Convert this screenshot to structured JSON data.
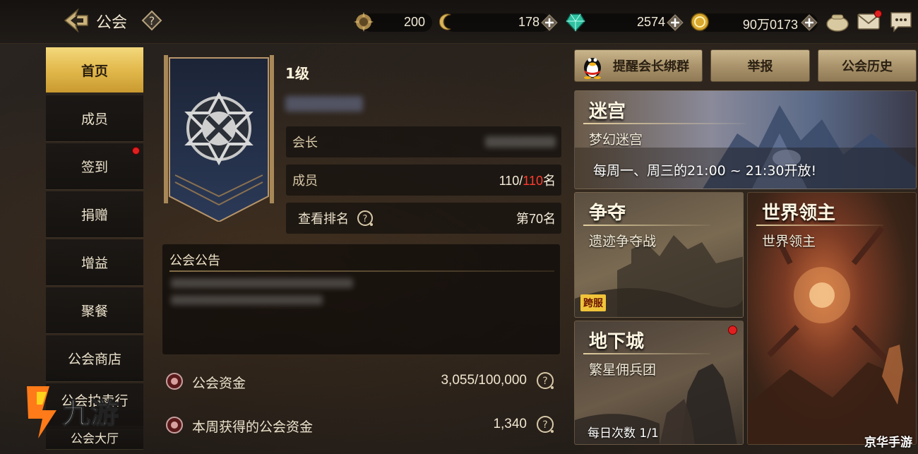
{
  "header": {
    "title": "公会",
    "resources": [
      {
        "icon": "sun-medal-icon",
        "value": "200",
        "has_plus": false
      },
      {
        "icon": "gold-crescent-icon",
        "value": "178",
        "has_plus": true
      },
      {
        "icon": "green-crystal-icon",
        "value": "2574",
        "has_plus": true
      },
      {
        "icon": "gold-coin-icon",
        "value": "90万0173",
        "has_plus": true
      }
    ]
  },
  "sidebar": {
    "items": [
      {
        "label": "首页",
        "active": true
      },
      {
        "label": "成员"
      },
      {
        "label": "签到",
        "badge": true
      },
      {
        "label": "捐赠"
      },
      {
        "label": "增益"
      },
      {
        "label": "聚餐"
      },
      {
        "label": "公会商店"
      },
      {
        "label": "公会拍卖行"
      },
      {
        "label": "公会大厅"
      }
    ]
  },
  "guild": {
    "level": "1级",
    "leader_label": "会长",
    "members_label": "成员",
    "members_current": "110/",
    "members_max": "110",
    "members_unit": "名",
    "rank_label": "查看排名",
    "rank_value": "第70名"
  },
  "notice": {
    "title": "公会公告"
  },
  "funds": [
    {
      "label": "公会资金",
      "value": "3,055/100,000"
    },
    {
      "label": "本周获得的公会资金",
      "value": "1,340"
    }
  ],
  "actions": {
    "remind": "提醒会长绑群",
    "report": "举报",
    "history": "公会历史"
  },
  "activities": {
    "maze": {
      "title": "迷宫",
      "subtitle": "梦幻迷宫",
      "desc": "每周一、周三的21:00 ~ 21:30开放!"
    },
    "contest": {
      "title": "争夺",
      "subtitle": "遗迹争夺战",
      "tag": "跨服"
    },
    "world_boss": {
      "title": "世界领主",
      "subtitle": "世界领主"
    },
    "dungeon": {
      "title": "地下城",
      "subtitle": "繁星佣兵团",
      "daily": "每日次数 1/1"
    }
  },
  "watermarks": {
    "left": "九游",
    "right": "京华手游"
  },
  "colors": {
    "accent_gold": "#e2b94c",
    "badge_red": "#e02020",
    "member_max_red": "#ff3b2f"
  }
}
